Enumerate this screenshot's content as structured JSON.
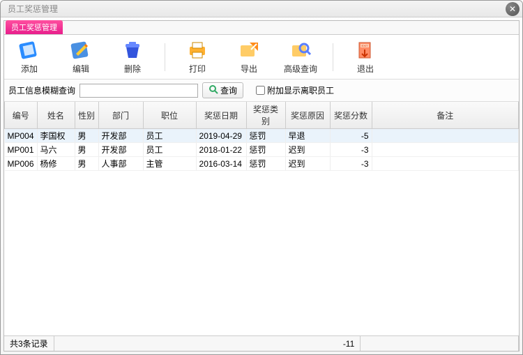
{
  "window": {
    "title": "员工奖惩管理"
  },
  "tab": {
    "label": "员工奖惩管理"
  },
  "toolbar": {
    "add": "添加",
    "edit": "编辑",
    "delete": "删除",
    "print": "打印",
    "export": "导出",
    "advanced": "高级查询",
    "exit": "退出"
  },
  "search": {
    "label": "员工信息模糊查询",
    "value": "",
    "button": "查询",
    "checkbox_label": "附加显示离职员工"
  },
  "columns": [
    "编号",
    "姓名",
    "性别",
    "部门",
    "职位",
    "奖惩日期",
    "奖惩类别",
    "奖惩原因",
    "奖惩分数",
    "备注"
  ],
  "rows": [
    {
      "id": "MP004",
      "name": "李国权",
      "sex": "男",
      "dept": "开发部",
      "pos": "员工",
      "date": "2019-04-29",
      "type": "惩罚",
      "reason": "早退",
      "score": "-5",
      "note": ""
    },
    {
      "id": "MP001",
      "name": "马六",
      "sex": "男",
      "dept": "开发部",
      "pos": "员工",
      "date": "2018-01-22",
      "type": "惩罚",
      "reason": "迟到",
      "score": "-3",
      "note": ""
    },
    {
      "id": "MP006",
      "name": "杨修",
      "sex": "男",
      "dept": "人事部",
      "pos": "主管",
      "date": "2016-03-14",
      "type": "惩罚",
      "reason": "迟到",
      "score": "-3",
      "note": ""
    }
  ],
  "status": {
    "count_text": "共3条记录",
    "sum": "-11"
  },
  "icons": {
    "add_color": "#2a8cff",
    "edit_color": "#4a90e2",
    "del_color": "#3355dd",
    "print_color": "#ffb030",
    "export_color": "#ff8c1a",
    "adv_color": "#ffc040",
    "exit_color": "#ff5a3c"
  }
}
